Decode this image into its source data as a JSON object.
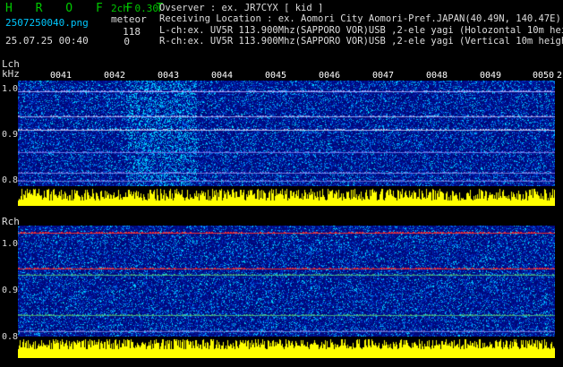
{
  "header": {
    "brand": "H R O F F T",
    "version": "2ch 0.30",
    "filename": "2507250040.png",
    "timestamp": "25.07.25 00:40",
    "meteor_label": "meteor",
    "count_lch": "118",
    "count_rch": "0",
    "observer_line": "Ovserver            : ex. JR7CYX [ kid ]",
    "location_line": "Receiving Location : ex. Aomori City Aomori-Pref.JAPAN(40.49N, 140.47E)",
    "lch_line": "L-ch:ex. UV5R 113.900Mhz(SAPPORO VOR)USB ,2-ele yagi (Holozontal 10m height)",
    "rch_line": "R-ch:ex. UV5R 113.900Mhz(SAPPORO VOR)USB ,2-ele yagi (Vertical 10m height)"
  },
  "lch": {
    "label": "Lch",
    "unit": "kHz",
    "yticks": [
      "1.0",
      "0.9",
      "0.8"
    ]
  },
  "rch": {
    "label": "Rch",
    "yticks": [
      "1.0",
      "0.9",
      "0.8"
    ]
  },
  "time_labels": [
    "0041",
    "0042",
    "0043",
    "0044",
    "0045",
    "0046",
    "0047",
    "0048",
    "0049",
    "0050",
    "2"
  ],
  "colors": {
    "header_text": "#e8e8e8",
    "brand": "#00c800",
    "signal_yellow": "#ffff00",
    "baseline_cyan": "#00ffff",
    "waterfall_bg": "#000a7a"
  }
}
